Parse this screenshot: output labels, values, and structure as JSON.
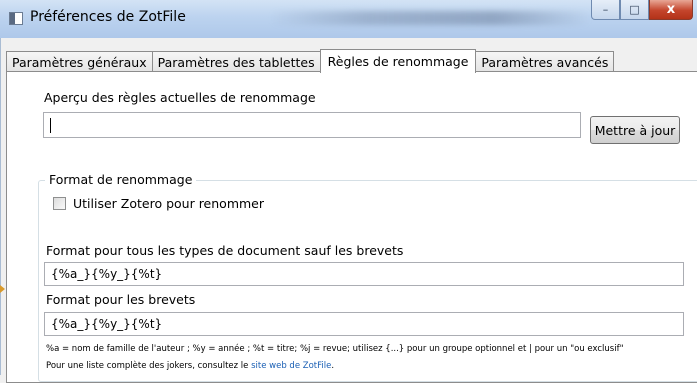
{
  "window": {
    "title": "Préférences de ZotFile",
    "buttons": {
      "minimize": "–",
      "maximize": "□",
      "close": "x"
    }
  },
  "tabs": [
    {
      "label": "Paramètres généraux",
      "active": false
    },
    {
      "label": "Paramètres des tablettes",
      "active": false
    },
    {
      "label": "Règles de renommage",
      "active": true
    },
    {
      "label": "Paramètres avancés",
      "active": false
    }
  ],
  "preview": {
    "label": "Aperçu des règles actuelles de renommage",
    "value": "",
    "update_button": "Mettre à jour"
  },
  "format_group": {
    "legend": "Format de renommage",
    "use_zotero_checkbox": {
      "label": "Utiliser Zotero pour renommer",
      "checked": false
    },
    "all_types_label": "Format pour tous les types de document sauf les brevets",
    "all_types_value": "{%a_}{%y_}{%t}",
    "patents_label": "Format pour les brevets",
    "patents_value": "{%a_}{%y_}{%t}",
    "help_line1": "%a = nom de famille de l'auteur ;  %y = année ;  %t = titre;  %j = revue;  utilisez {...} pour un groupe optionnel et | pour un \"ou exclusif\"",
    "help_line2_prefix": "Pour une liste complète des jokers, consultez le ",
    "help_line2_link": "site web de ZotFile",
    "help_line2_suffix": "."
  },
  "colors": {
    "titlebar": "#bcd3ef",
    "close_button": "#c4452c",
    "link": "#1a5fb4"
  }
}
